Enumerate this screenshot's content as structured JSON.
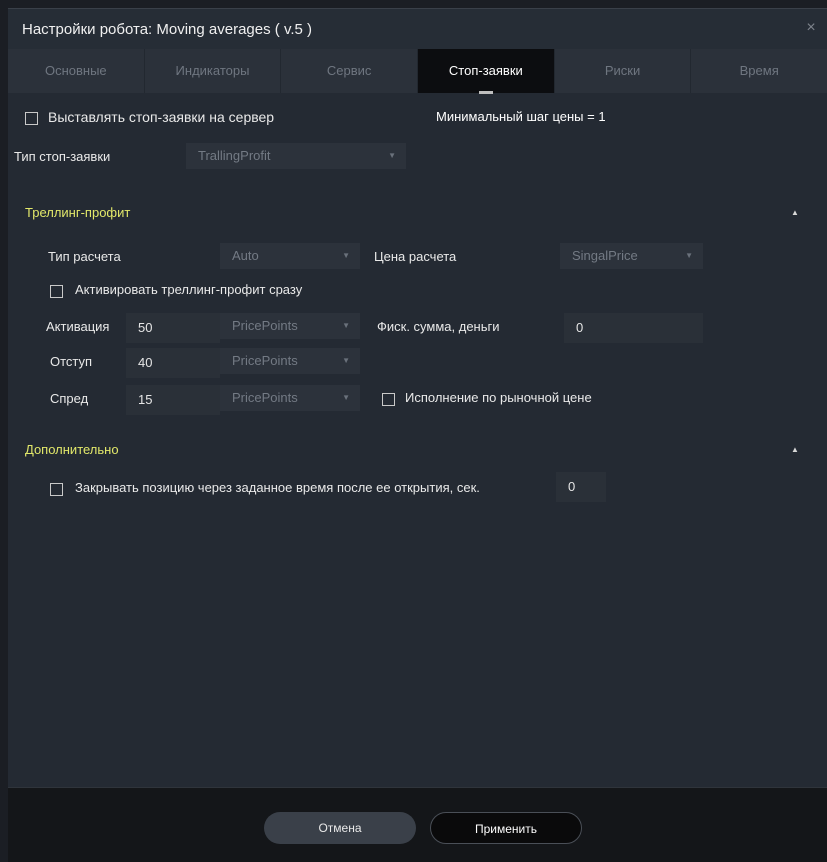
{
  "window": {
    "title": "Настройки робота: Moving averages ( v.5 )",
    "close_glyph": "×"
  },
  "tabs": [
    {
      "label": "Основные"
    },
    {
      "label": "Индикаторы"
    },
    {
      "label": "Сервис"
    },
    {
      "label": "Стоп-заявки",
      "active": true
    },
    {
      "label": "Риски"
    },
    {
      "label": "Время"
    }
  ],
  "stop_orders": {
    "send_to_server_label": "Выставлять стоп-заявки на сервер",
    "send_to_server_checked": false,
    "min_step_text": "Минимальный шаг цены =  1",
    "type_label": "Тип стоп-заявки",
    "type_value": "TrallingProfit"
  },
  "trailing": {
    "section_title": "Треллинг-профит",
    "calc_type_label": "Тип расчета",
    "calc_type_value": "Auto",
    "calc_price_label": "Цена расчета",
    "calc_price_value": "SingalPrice",
    "activate_now_label": "Активировать треллинг-профит сразу",
    "activate_now_checked": false,
    "activation_label": "Активация",
    "activation_value": "50",
    "activation_unit": "PricePoints",
    "fix_sum_label": "Фиск. сумма, деньги",
    "fix_sum_value": "0",
    "offset_label": "Отступ",
    "offset_value": "40",
    "offset_unit": "PricePoints",
    "spread_label": "Спред",
    "spread_value": "15",
    "spread_unit": "PricePoints",
    "market_exec_label": "Исполнение по рыночной цене",
    "market_exec_checked": false
  },
  "additional": {
    "section_title": "Дополнительно",
    "close_after_label": "Закрывать позицию через заданное время после ее открытия, сек.",
    "close_after_checked": false,
    "close_after_value": "0"
  },
  "footer": {
    "cancel_label": "Отмена",
    "apply_label": "Применить"
  },
  "colors": {
    "accent_section": "#e2e86a",
    "background": "#242a33",
    "active_tab": "#0c0d10"
  },
  "icons": {
    "dropdown": "▼",
    "collapse": "▲"
  }
}
